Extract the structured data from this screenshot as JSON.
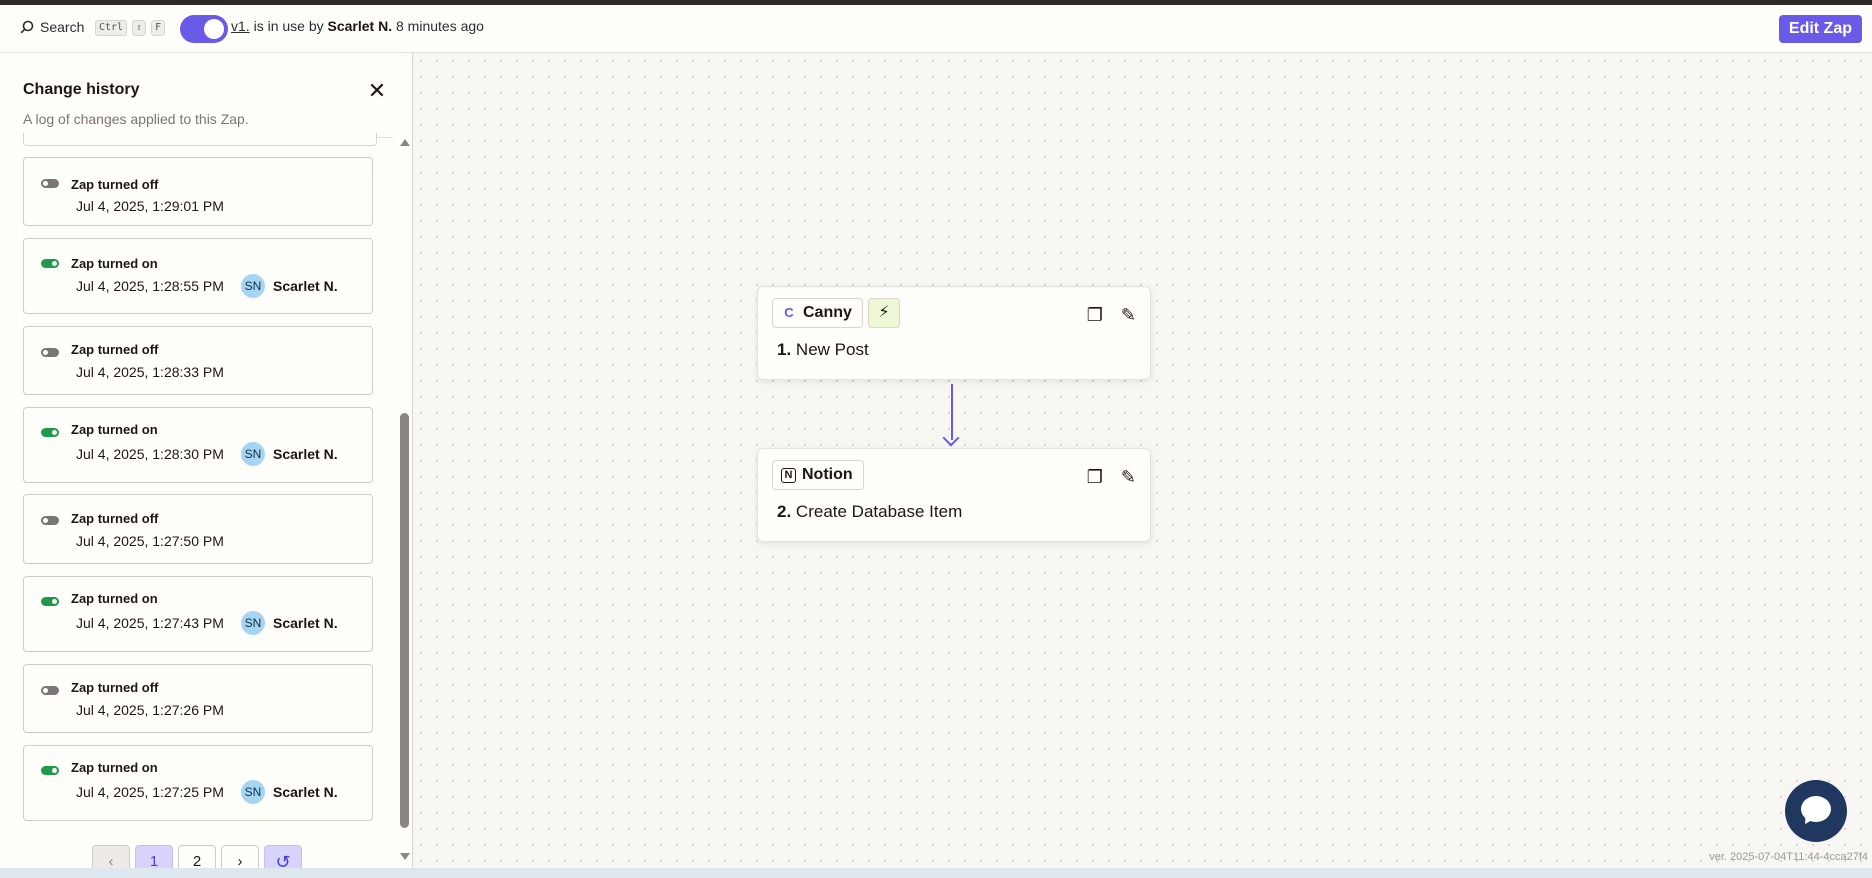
{
  "topbar": {
    "search_label": "Search",
    "shortcut_keys": [
      "Ctrl",
      "⇧",
      "F"
    ],
    "version_link": "v1.",
    "in_use_text": "is in use by",
    "user": "Scarlet N.",
    "time_ago": "8 minutes ago",
    "edit_zap_label": "Edit Zap"
  },
  "panel": {
    "title": "Change history",
    "subtitle": "A log of changes applied to this Zap.",
    "entries": [
      {
        "status": "Zap turned off",
        "date": "Jul 4, 2025, 1:29:01 PM",
        "state": "off"
      },
      {
        "status": "Zap turned on",
        "date": "Jul 4, 2025, 1:28:55 PM",
        "state": "on",
        "avatar": "SN",
        "user": "Scarlet N."
      },
      {
        "status": "Zap turned off",
        "date": "Jul 4, 2025, 1:28:33 PM",
        "state": "off"
      },
      {
        "status": "Zap turned on",
        "date": "Jul 4, 2025, 1:28:30 PM",
        "state": "on",
        "avatar": "SN",
        "user": "Scarlet N."
      },
      {
        "status": "Zap turned off",
        "date": "Jul 4, 2025, 1:27:50 PM",
        "state": "off"
      },
      {
        "status": "Zap turned on",
        "date": "Jul 4, 2025, 1:27:43 PM",
        "state": "on",
        "avatar": "SN",
        "user": "Scarlet N."
      },
      {
        "status": "Zap turned off",
        "date": "Jul 4, 2025, 1:27:26 PM",
        "state": "off"
      },
      {
        "status": "Zap turned on",
        "date": "Jul 4, 2025, 1:27:25 PM",
        "state": "on",
        "avatar": "SN",
        "user": "Scarlet N."
      }
    ],
    "pagination": {
      "pages": [
        "1",
        "2"
      ],
      "current": "1"
    }
  },
  "canvas": {
    "steps": [
      {
        "app": "Canny",
        "number": "1.",
        "title": "New Post"
      },
      {
        "app": "Notion",
        "number": "2.",
        "title": "Create Database Item"
      }
    ],
    "accent_color": "#695be8"
  },
  "footer": {
    "version_text": "ver. 2025-07-04T11:44-4cca27f4"
  }
}
